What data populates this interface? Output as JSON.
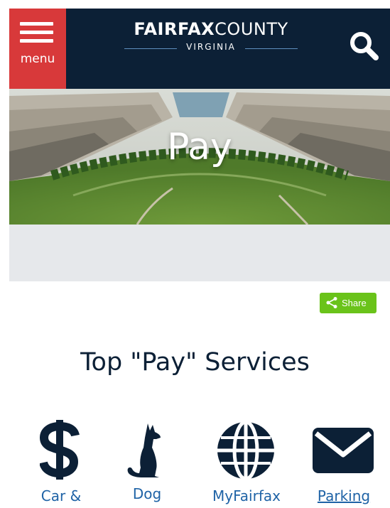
{
  "header": {
    "menu_label": "menu",
    "logo_bold": "FAIRFAX",
    "logo_light": "COUNTY",
    "logo_sub": "VIRGINIA",
    "colors": {
      "navy": "#0c2036",
      "menu_red": "#d8393a"
    },
    "icons": {
      "menu": "hamburger-icon",
      "search": "search-icon"
    }
  },
  "hero": {
    "title": "Pay"
  },
  "share": {
    "label": "Share",
    "icon": "share-icon",
    "color": "#6ac31a"
  },
  "services": {
    "title": "Top \"Pay\" Services",
    "items": [
      {
        "label": "Car &",
        "icon": "dollar-icon"
      },
      {
        "label": "Dog",
        "icon": "dog-icon"
      },
      {
        "label": "MyFairfax",
        "icon": "globe-icon"
      },
      {
        "label": "Parking",
        "icon": "envelope-icon"
      }
    ]
  }
}
